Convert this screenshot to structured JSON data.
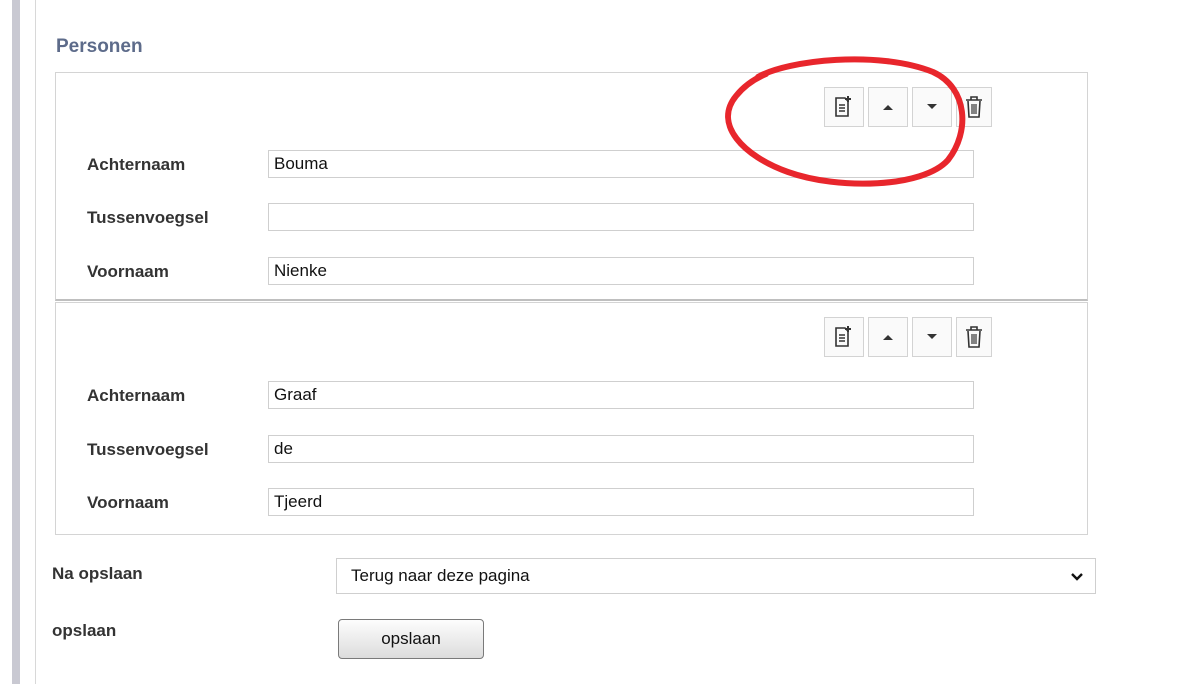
{
  "section": {
    "title": "Personen"
  },
  "persons": [
    {
      "fields": [
        {
          "label": "Achternaam",
          "value": "Bouma"
        },
        {
          "label": "Tussenvoegsel",
          "value": ""
        },
        {
          "label": "Voornaam",
          "value": "Nienke"
        }
      ]
    },
    {
      "fields": [
        {
          "label": "Achternaam",
          "value": "Graaf"
        },
        {
          "label": "Tussenvoegsel",
          "value": "de"
        },
        {
          "label": "Voornaam",
          "value": "Tjeerd"
        }
      ]
    }
  ],
  "toolbar_icons": [
    "add-document-icon",
    "arrow-up-icon",
    "arrow-down-icon",
    "trash-icon"
  ],
  "after_save": {
    "label": "Na opslaan",
    "selected": "Terug naar deze pagina"
  },
  "save": {
    "label": "opslaan",
    "button_label": "opslaan"
  },
  "colors": {
    "section_title": "#5d6b8a",
    "annotation_circle": "#e8262c"
  }
}
